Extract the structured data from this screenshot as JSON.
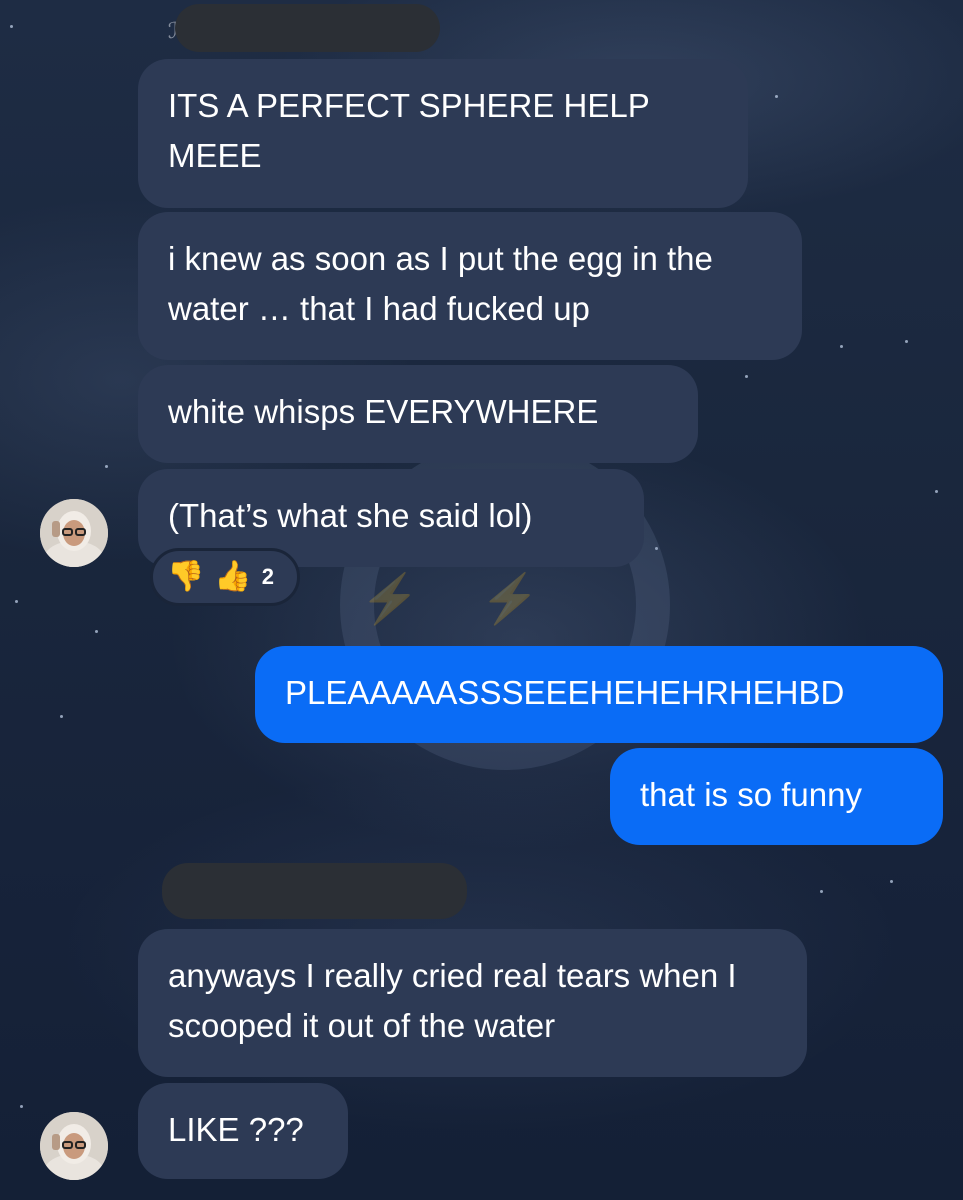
{
  "conversation": {
    "messages": [
      {
        "sender": "other",
        "text": "ITS A PERFECT SPHERE HELP MEEE"
      },
      {
        "sender": "other",
        "text": "i knew as soon as I put the egg in the water … that I had fucked up"
      },
      {
        "sender": "other",
        "text": "white whisps EVERYWHERE"
      },
      {
        "sender": "other",
        "text": "(That’s what she said lol)"
      },
      {
        "sender": "me",
        "text": "PLEAAAAASSSEEEHEHEHRHEHBD"
      },
      {
        "sender": "me",
        "text": "that is so funny"
      },
      {
        "sender": "other",
        "text": "anyways I really cried real tears when I scooped it out of the water"
      },
      {
        "sender": "other",
        "text": "LIKE ???"
      }
    ],
    "reactions": {
      "items": [
        {
          "icon": "thumbs-down-icon",
          "glyph": "👎"
        },
        {
          "icon": "thumbs-up-icon",
          "glyph": "👍"
        }
      ],
      "count": "2"
    }
  },
  "colors": {
    "incoming_bubble": "#2d3a55",
    "outgoing_bubble": "#0a6cf6",
    "text": "#ffffff",
    "redaction": "#2b2f35"
  }
}
